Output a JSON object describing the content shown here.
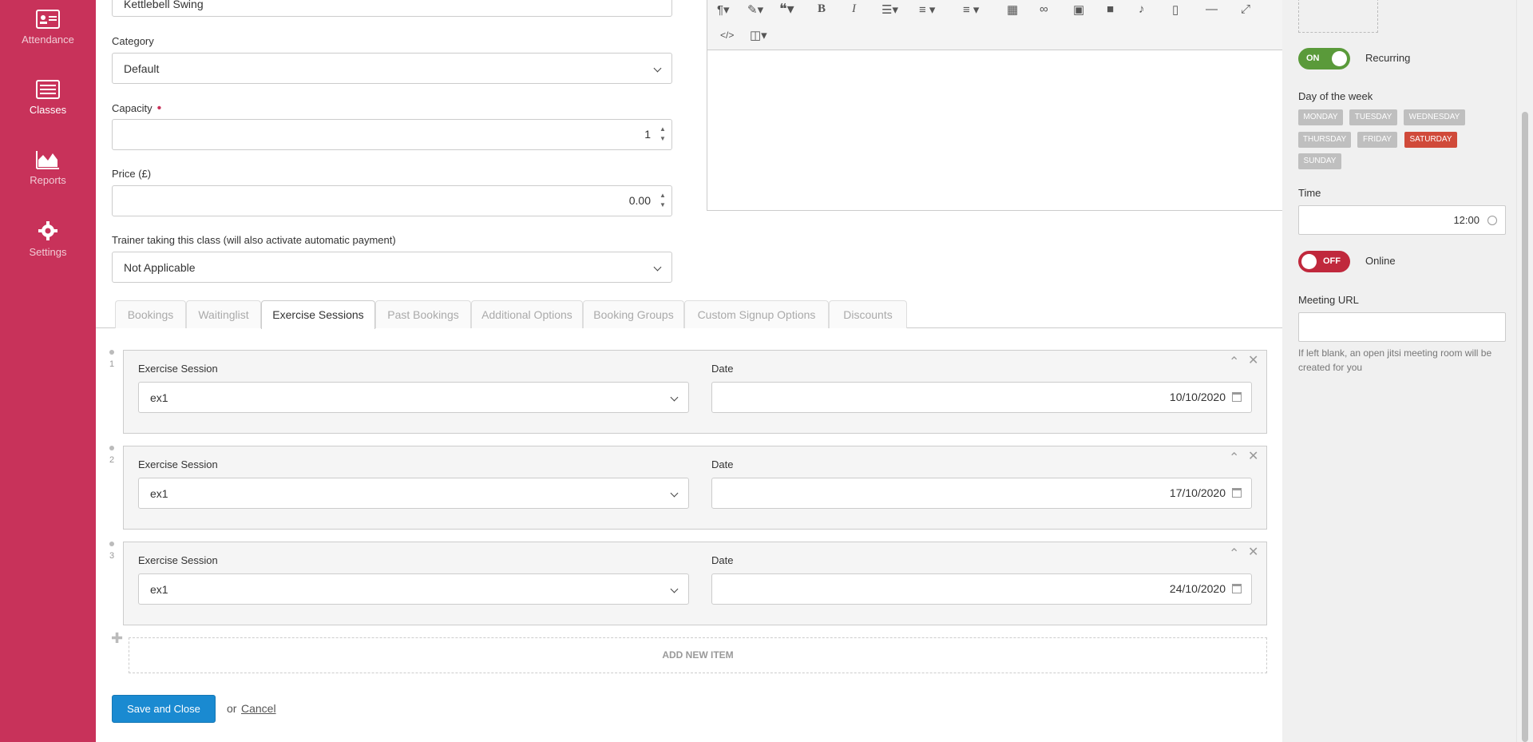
{
  "sidebar": {
    "items": [
      {
        "label": "Attendance",
        "icon": "id-card-icon"
      },
      {
        "label": "Classes",
        "icon": "list-icon"
      },
      {
        "label": "Reports",
        "icon": "area-chart-icon"
      },
      {
        "label": "Settings",
        "icon": "gear-icon"
      }
    ]
  },
  "form": {
    "title_value": "Kettlebell Swing",
    "category_label": "Category",
    "category_value": "Default",
    "capacity_label": "Capacity",
    "capacity_value": "1",
    "price_label": "Price (£)",
    "price_value": "0.00",
    "trainer_label": "Trainer taking this class (will also activate automatic payment)",
    "trainer_value": "Not Applicable"
  },
  "tabs": [
    {
      "label": "Bookings",
      "active": false
    },
    {
      "label": "Waitinglist",
      "active": false
    },
    {
      "label": "Exercise Sessions",
      "active": true
    },
    {
      "label": "Past Bookings",
      "active": false
    },
    {
      "label": "Additional Options",
      "active": false
    },
    {
      "label": "Booking Groups",
      "active": false
    },
    {
      "label": "Custom Signup Options",
      "active": false
    },
    {
      "label": "Discounts",
      "active": false
    }
  ],
  "sessions": [
    {
      "index": "1",
      "session_label": "Exercise Session",
      "session_value": "ex1",
      "date_label": "Date",
      "date_value": "10/10/2020"
    },
    {
      "index": "2",
      "session_label": "Exercise Session",
      "session_value": "ex1",
      "date_label": "Date",
      "date_value": "17/10/2020"
    },
    {
      "index": "3",
      "session_label": "Exercise Session",
      "session_value": "ex1",
      "date_label": "Date",
      "date_value": "24/10/2020"
    }
  ],
  "add_item_label": "ADD NEW ITEM",
  "actions": {
    "save": "Save and Close",
    "or": "or",
    "cancel": "Cancel"
  },
  "right_panel": {
    "recurring": {
      "state": "ON",
      "label": "Recurring"
    },
    "day_label": "Day of the week",
    "days": [
      {
        "label": "MONDAY",
        "selected": false
      },
      {
        "label": "TUESDAY",
        "selected": false
      },
      {
        "label": "WEDNESDAY",
        "selected": false
      },
      {
        "label": "THURSDAY",
        "selected": false
      },
      {
        "label": "FRIDAY",
        "selected": false
      },
      {
        "label": "SATURDAY",
        "selected": true
      },
      {
        "label": "SUNDAY",
        "selected": false
      }
    ],
    "time_label": "Time",
    "time_value": "12:00",
    "online": {
      "state": "OFF",
      "label": "Online"
    },
    "meeting_url_label": "Meeting URL",
    "meeting_url_value": "",
    "meeting_help": "If left blank, an open jitsi meeting room will be created for you"
  },
  "colors": {
    "sidebar": "#c8325a",
    "primary_button": "#1a8ad1",
    "toggle_on": "#5a9a3a",
    "toggle_off": "#c0283c",
    "day_selected": "#d04a3a"
  }
}
